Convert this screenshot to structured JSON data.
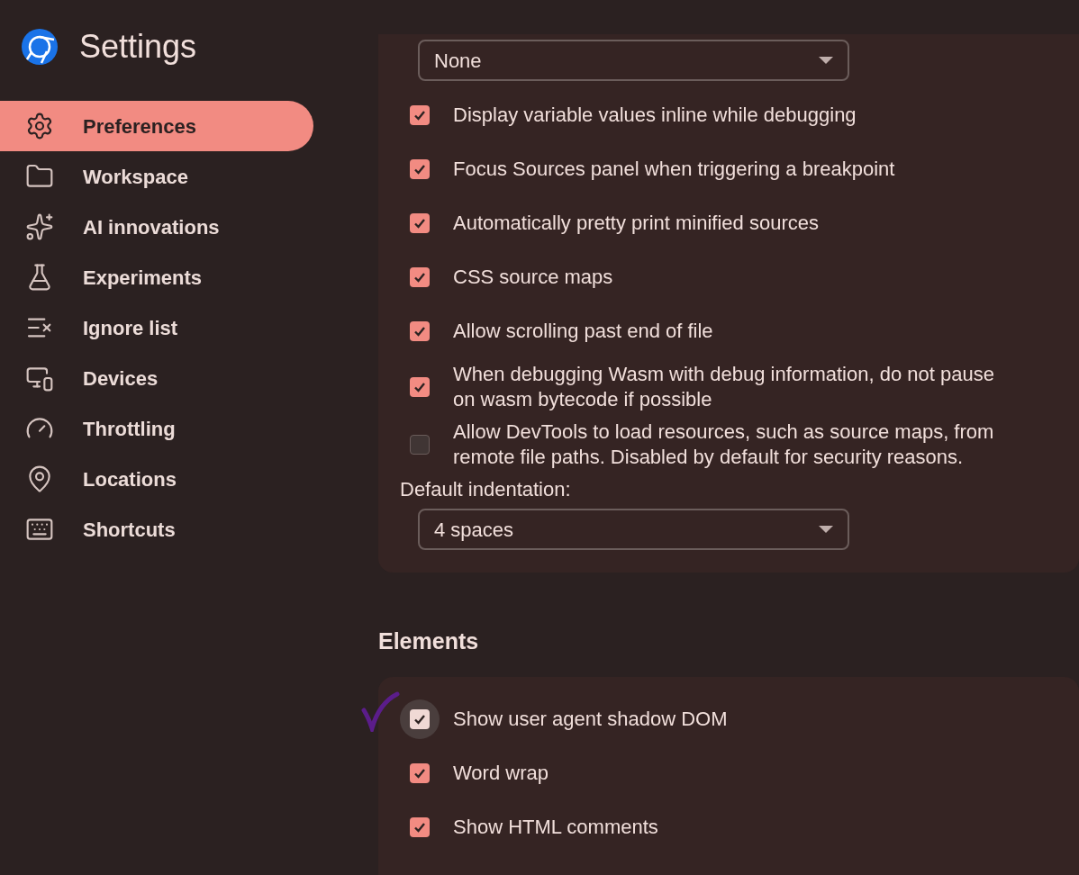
{
  "sidebar": {
    "title": "Settings",
    "items": [
      {
        "label": "Preferences",
        "selected": true
      },
      {
        "label": "Workspace",
        "selected": false
      },
      {
        "label": "AI innovations",
        "selected": false
      },
      {
        "label": "Experiments",
        "selected": false
      },
      {
        "label": "Ignore list",
        "selected": false
      },
      {
        "label": "Devices",
        "selected": false
      },
      {
        "label": "Throttling",
        "selected": false
      },
      {
        "label": "Locations",
        "selected": false
      },
      {
        "label": "Shortcuts",
        "selected": false
      }
    ]
  },
  "sources_card": {
    "top_dropdown": {
      "value": "None"
    },
    "options": [
      {
        "label": "Display variable values inline while debugging",
        "checked": true,
        "focused": false
      },
      {
        "label": "Focus Sources panel when triggering a breakpoint",
        "checked": true,
        "focused": false
      },
      {
        "label": "Automatically pretty print minified sources",
        "checked": true,
        "focused": false
      },
      {
        "label": "CSS source maps",
        "checked": true,
        "focused": false
      },
      {
        "label": "Allow scrolling past end of file",
        "checked": true,
        "focused": false
      },
      {
        "label": "When debugging Wasm with debug information, do not pause on wasm bytecode if possible",
        "checked": true,
        "focused": false
      },
      {
        "label": "Allow DevTools to load resources, such as source maps, from remote file paths. Disabled by default for security reasons.",
        "checked": false,
        "focused": false
      }
    ],
    "indentation": {
      "label": "Default indentation:",
      "value": "4 spaces"
    }
  },
  "elements_section": {
    "title": "Elements",
    "options": [
      {
        "label": "Show user agent shadow DOM",
        "checked": true,
        "focused": true,
        "annotated": true
      },
      {
        "label": "Word wrap",
        "checked": true,
        "focused": false,
        "annotated": false
      },
      {
        "label": "Show HTML comments",
        "checked": true,
        "focused": false,
        "annotated": false
      }
    ]
  }
}
